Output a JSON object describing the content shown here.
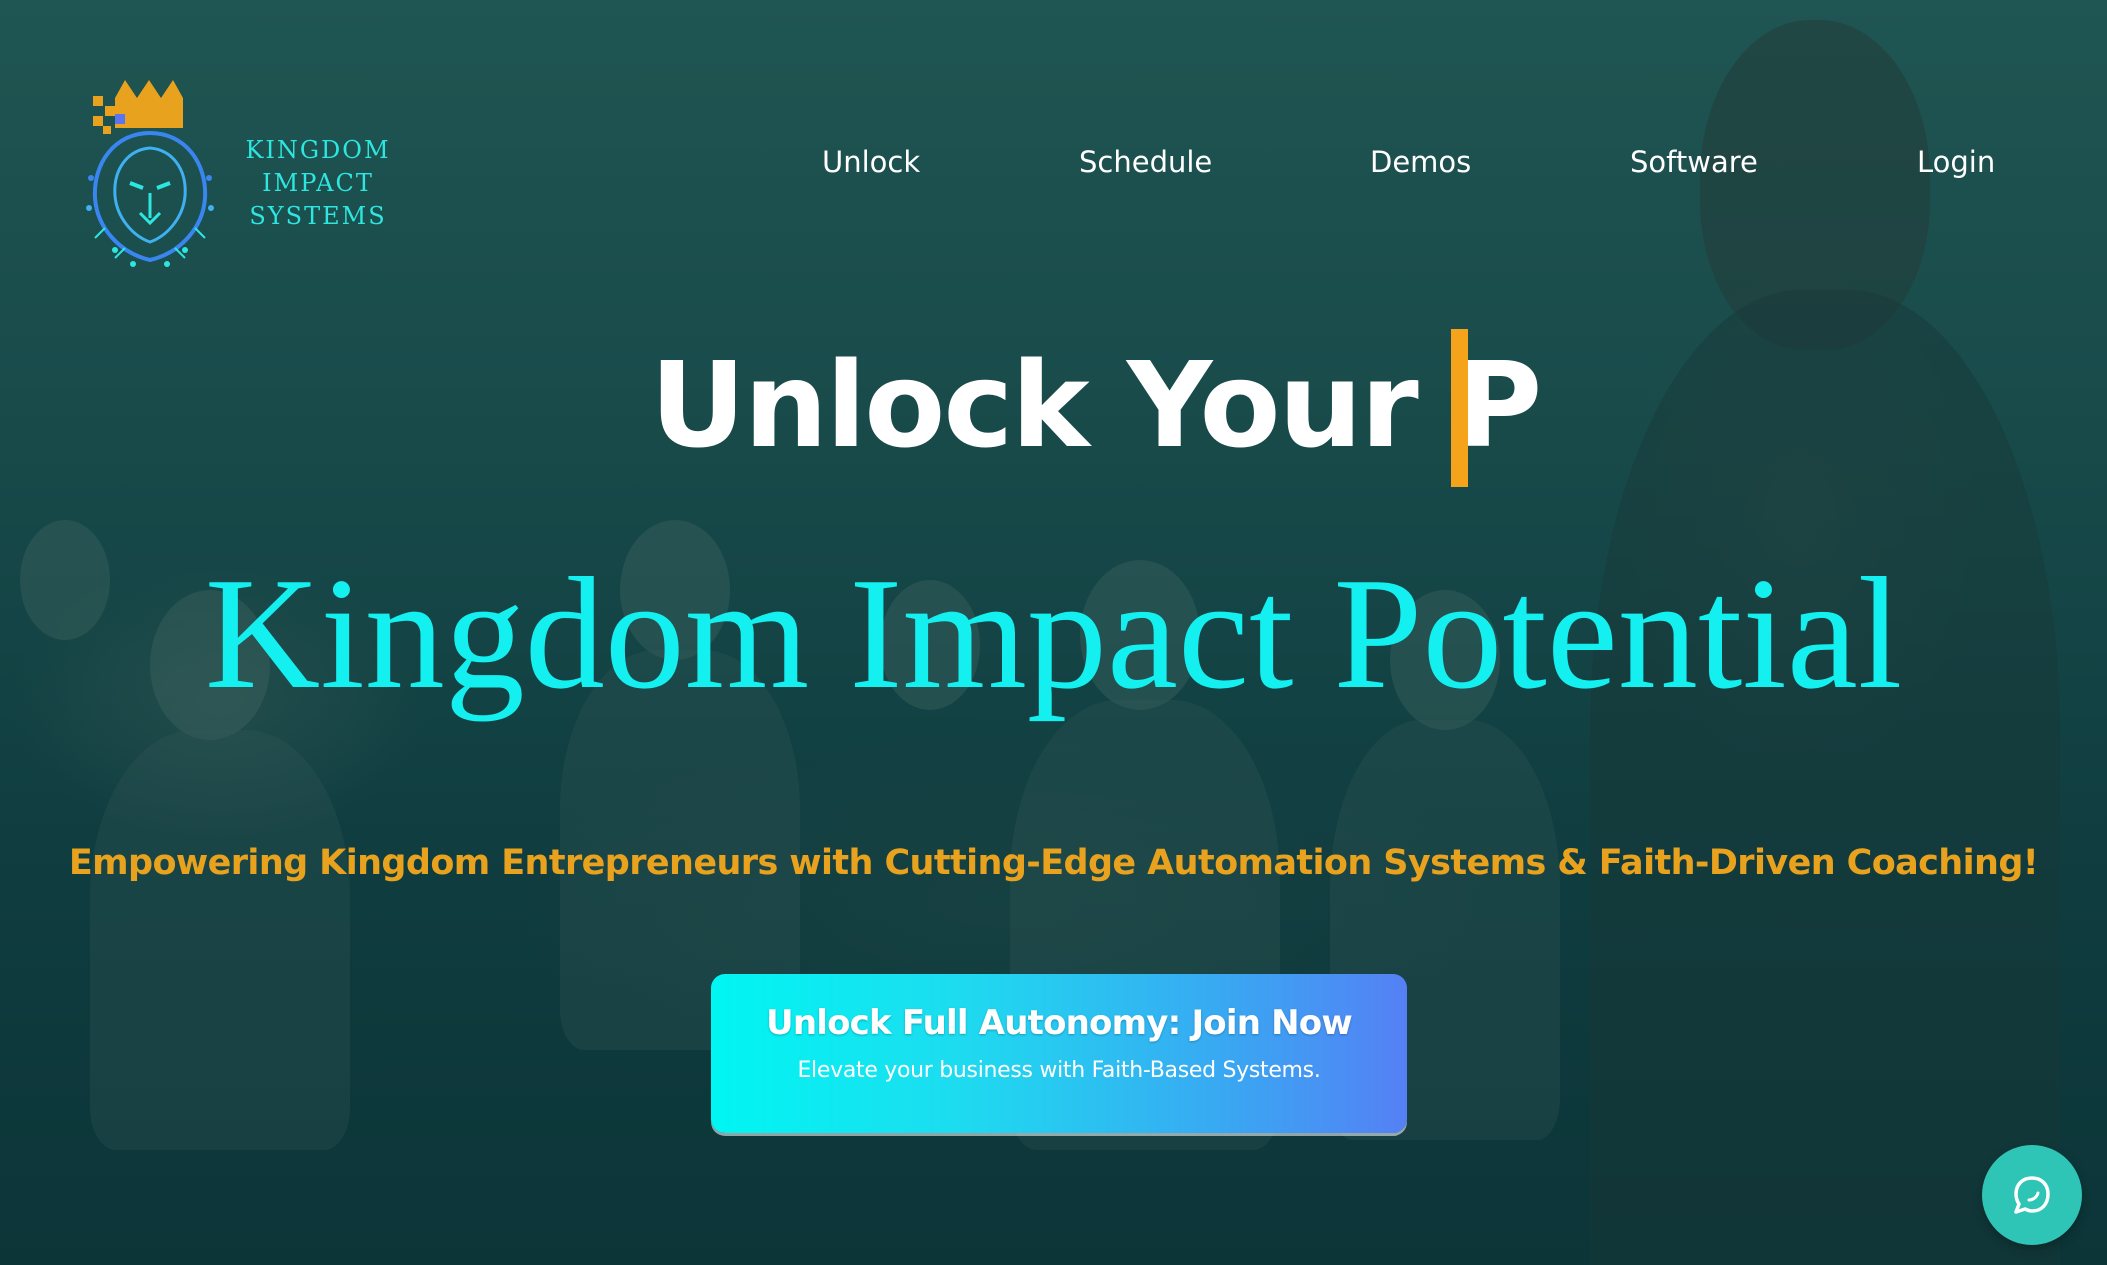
{
  "logo": {
    "lines": [
      "KINGDOM",
      "IMPACT",
      "SYSTEMS"
    ],
    "icon": "crowned-lion-icon"
  },
  "nav": {
    "items": [
      {
        "label": "Unlock"
      },
      {
        "label": "Schedule"
      },
      {
        "label": "Demos"
      },
      {
        "label": "Software"
      },
      {
        "label": "Login"
      }
    ]
  },
  "hero": {
    "typed_text": "Unlock Your  P",
    "headline": "Kingdom Impact Potential",
    "tagline": "Empowering Kingdom Entrepreneurs with Cutting-Edge Automation Systems & Faith-Driven Coaching!"
  },
  "cta": {
    "title": "Unlock Full Autonomy: Join Now",
    "subtitle": "Elevate your business with Faith-Based Systems."
  },
  "chat": {
    "icon": "chat-bubble-icon"
  },
  "colors": {
    "accent_cyan": "#14f0f0",
    "accent_gold": "#e8a21e",
    "cursor": "#f5a31a",
    "chat": "#2ec4b6"
  }
}
